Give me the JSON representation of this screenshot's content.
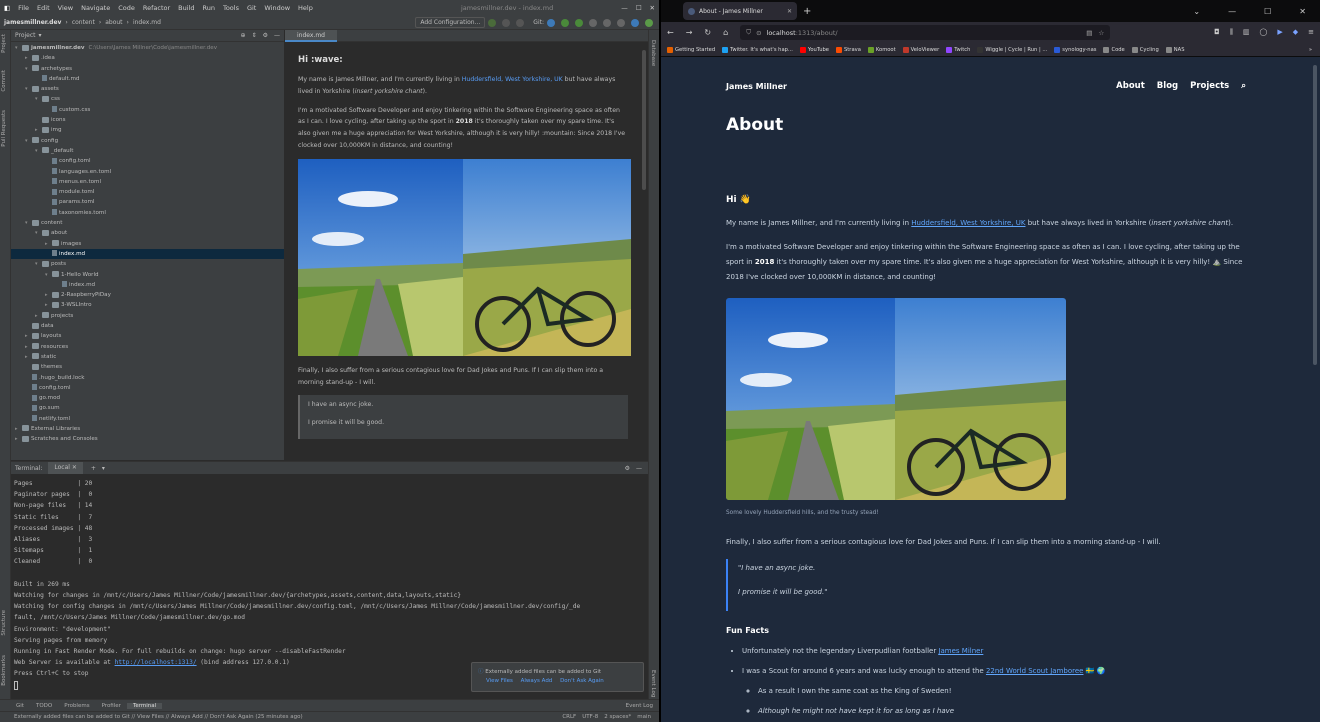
{
  "ide": {
    "menu": [
      "File",
      "Edit",
      "View",
      "Navigate",
      "Code",
      "Refactor",
      "Build",
      "Run",
      "Tools",
      "Git",
      "Window",
      "Help"
    ],
    "title": "jamesmillner.dev - index.md",
    "breadcrumbs": [
      "jamesmillner.dev",
      "content",
      "about",
      "index.md"
    ],
    "add_config": "Add Configuration...",
    "git_label": "Git:",
    "left_tools": [
      "Project",
      "Commit",
      "Pull Requests"
    ],
    "left_tools_bottom": [
      "Structure",
      "Bookmarks"
    ],
    "right_tools": [
      "Database"
    ],
    "right_tools_bottom": [
      "Event Log"
    ],
    "project_header": "Project",
    "tree": [
      {
        "label": "jamesmillner.dev",
        "extra": "C:\\Users\\James Millner\\Code\\jamesmillner.dev",
        "indent": 0,
        "type": "folder",
        "arrow": "▾",
        "bold": true
      },
      {
        "label": ".idea",
        "indent": 1,
        "type": "folder",
        "arrow": "▸"
      },
      {
        "label": "archetypes",
        "indent": 1,
        "type": "folder",
        "arrow": "▾"
      },
      {
        "label": "default.md",
        "indent": 2,
        "type": "file",
        "arrow": ""
      },
      {
        "label": "assets",
        "indent": 1,
        "type": "folder",
        "arrow": "▾"
      },
      {
        "label": "css",
        "indent": 2,
        "type": "folder",
        "arrow": "▾"
      },
      {
        "label": "custom.css",
        "indent": 3,
        "type": "file",
        "arrow": ""
      },
      {
        "label": "icons",
        "indent": 2,
        "type": "folder",
        "arrow": ""
      },
      {
        "label": "img",
        "indent": 2,
        "type": "folder",
        "arrow": "▸"
      },
      {
        "label": "config",
        "indent": 1,
        "type": "folder",
        "arrow": "▾"
      },
      {
        "label": "_default",
        "indent": 2,
        "type": "folder",
        "arrow": "▾"
      },
      {
        "label": "config.toml",
        "indent": 3,
        "type": "file",
        "arrow": ""
      },
      {
        "label": "languages.en.toml",
        "indent": 3,
        "type": "file",
        "arrow": ""
      },
      {
        "label": "menus.en.toml",
        "indent": 3,
        "type": "file",
        "arrow": ""
      },
      {
        "label": "module.toml",
        "indent": 3,
        "type": "file",
        "arrow": ""
      },
      {
        "label": "params.toml",
        "indent": 3,
        "type": "file",
        "arrow": ""
      },
      {
        "label": "taxonomies.toml",
        "indent": 3,
        "type": "file",
        "arrow": ""
      },
      {
        "label": "content",
        "indent": 1,
        "type": "folder",
        "arrow": "▾"
      },
      {
        "label": "about",
        "indent": 2,
        "type": "folder",
        "arrow": "▾"
      },
      {
        "label": "images",
        "indent": 3,
        "type": "folder",
        "arrow": "▸"
      },
      {
        "label": "index.md",
        "indent": 3,
        "type": "file",
        "arrow": "",
        "selected": true
      },
      {
        "label": "posts",
        "indent": 2,
        "type": "folder",
        "arrow": "▾"
      },
      {
        "label": "1-Hello World",
        "indent": 3,
        "type": "folder",
        "arrow": "▾"
      },
      {
        "label": "index.md",
        "indent": 4,
        "type": "file",
        "arrow": ""
      },
      {
        "label": "2-RaspberryPiDay",
        "indent": 3,
        "type": "folder",
        "arrow": "▸"
      },
      {
        "label": "3-WSLIntro",
        "indent": 3,
        "type": "folder",
        "arrow": "▸"
      },
      {
        "label": "projects",
        "indent": 2,
        "type": "folder",
        "arrow": "▸"
      },
      {
        "label": "data",
        "indent": 1,
        "type": "folder",
        "arrow": ""
      },
      {
        "label": "layouts",
        "indent": 1,
        "type": "folder",
        "arrow": "▸"
      },
      {
        "label": "resources",
        "indent": 1,
        "type": "folder",
        "arrow": "▸"
      },
      {
        "label": "static",
        "indent": 1,
        "type": "folder",
        "arrow": "▸"
      },
      {
        "label": "themes",
        "indent": 1,
        "type": "folder",
        "arrow": ""
      },
      {
        "label": ".hugo_build.lock",
        "indent": 1,
        "type": "file",
        "arrow": ""
      },
      {
        "label": "config.toml",
        "indent": 1,
        "type": "file",
        "arrow": ""
      },
      {
        "label": "go.mod",
        "indent": 1,
        "type": "file",
        "arrow": ""
      },
      {
        "label": "go.sum",
        "indent": 1,
        "type": "file",
        "arrow": ""
      },
      {
        "label": "netlify.toml",
        "indent": 1,
        "type": "file",
        "arrow": ""
      },
      {
        "label": "External Libraries",
        "indent": 0,
        "type": "folder",
        "arrow": "▸"
      },
      {
        "label": "Scratches and Consoles",
        "indent": 0,
        "type": "folder",
        "arrow": "▸"
      }
    ],
    "editor_tab": "index.md",
    "preview": {
      "heading": "Hi :wave:",
      "p1_a": "My name is James Millner, and I'm currently living in ",
      "p1_link": "Huddersfield, West Yorkshire, UK",
      "p1_b": " but have always lived in Yorkshire (",
      "p1_em": "insert yorkshire chant",
      "p1_c": ").",
      "p2_a": "I'm a motivated Software Developer and enjoy tinkering within the Software Engineering space as often as I can. I love cycling, after taking up the sport in ",
      "p2_year": "2018",
      "p2_b": " it's thoroughly taken over my spare time. It's also given me a huge appreciation for West Yorkshire, although it is very hilly! :mountain: Since 2018 I've clocked over 10,000KM in distance, and counting!",
      "p3": "Finally, I also suffer from a serious contagious love for Dad Jokes and Puns. If I can slip them into a morning stand-up - I will.",
      "quote1": "I have an async joke.",
      "quote2": "I promise it will be good."
    },
    "terminal_label": "Terminal:",
    "terminal_tab": "Local",
    "terminal_lines": [
      "Pages            | 20",
      "Paginator pages  |  0",
      "Non-page files   | 14",
      "Static files     |  7",
      "Processed images | 48",
      "Aliases          |  3",
      "Sitemaps         |  1",
      "Cleaned          |  0",
      "",
      "Built in 269 ms",
      "Watching for changes in /mnt/c/Users/James Millner/Code/jamesmillner.dev/{archetypes,assets,content,data,layouts,static}",
      "Watching for config changes in /mnt/c/Users/James Millner/Code/jamesmillner.dev/config.toml, /mnt/c/Users/James Millner/Code/jamesmillner.dev/config/_de",
      "fault, /mnt/c/Users/James Millner/Code/jamesmillner.dev/go.mod",
      "Environment: \"development\"",
      "Serving pages from memory",
      "Running in Fast Render Mode. For full rebuilds on change: hugo server --disableFastRender"
    ],
    "web_server_prefix": "Web Server is available at ",
    "web_server_url": "http://localhost:1313/",
    "web_server_suffix": " (bind address 127.0.0.1)",
    "press_ctrl": "Press Ctrl+C to stop",
    "notification": {
      "text": "Externally added files can be added to Git",
      "view": "View Files",
      "always": "Always Add",
      "dont": "Don't Ask Again"
    },
    "bottom_tabs": [
      "Git",
      "TODO",
      "Problems",
      "Profiler",
      "Terminal"
    ],
    "status_left": "Externally added files can be added to Git // View Files // Always Add // Don't Ask Again (25 minutes ago)",
    "status_right": [
      "CRLF",
      "UTF-8",
      "2 spaces*",
      "main"
    ],
    "event_log": "Event Log"
  },
  "firefox": {
    "tab_title": "About - James Millner",
    "url_host": "localhost",
    "url_path": ":1313/about/",
    "bookmarks": [
      {
        "label": "Getting Started",
        "color": "#e66000"
      },
      {
        "label": "Twitter. It's what's hap...",
        "color": "#1da1f2"
      },
      {
        "label": "YouTube",
        "color": "#ff0000"
      },
      {
        "label": "Strava",
        "color": "#fc4c02"
      },
      {
        "label": "Komoot",
        "color": "#6aa127"
      },
      {
        "label": "VeloViewer",
        "color": "#c0392b"
      },
      {
        "label": "Twitch",
        "color": "#9146ff"
      },
      {
        "label": "Wiggle | Cycle | Run | ...",
        "color": "#333333"
      },
      {
        "label": "synology-nas",
        "color": "#2a5bd7"
      },
      {
        "label": "Code",
        "color": "#888888"
      },
      {
        "label": "Cycling",
        "color": "#888888"
      },
      {
        "label": "NAS",
        "color": "#888888"
      }
    ],
    "site": {
      "brand": "James Millner",
      "nav": [
        "About",
        "Blog",
        "Projects"
      ],
      "title": "About",
      "greeting": "Hi 👋",
      "p1_a": "My name is James Millner, and I'm currently living in ",
      "p1_link": "Huddersfield, West Yorkshire, UK",
      "p1_b": " but have always lived in Yorkshire (",
      "p1_em": "insert yorkshire chant",
      "p1_c": ").",
      "p2_a": "I'm a motivated Software Developer and enjoy tinkering within the Software Engineering space as often as I can. I love cycling, after taking up the sport in ",
      "p2_year": "2018",
      "p2_b": " it's thoroughly taken over my spare time. It's also given me a huge appreciation for West Yorkshire, although it is very hilly! ⛰️ Since 2018 I've clocked over 10,000KM in distance, and counting!",
      "caption": "Some lovely Huddersfield hills, and the trusty stead!",
      "p3": "Finally, I also suffer from a serious contagious love for Dad Jokes and Puns. If I can slip them into a morning stand-up - I will.",
      "quote1": "\"I have an async joke.",
      "quote2": "I promise it will be good.\"",
      "fun_facts": "Fun Facts",
      "fact1_a": "Unfortunately not the legendary Liverpudlian footballer ",
      "fact1_link": "James Milner",
      "fact2_a": "I was a Scout for around 6 years and was lucky enough to attend the ",
      "fact2_link": "22nd World Scout Jamboree",
      "fact2_b": " 🇸🇪 🌍",
      "sub1": "As a result I own the same coat as the King of Sweden!",
      "sub2": "Although he might not have kept it for as long as I have"
    }
  }
}
